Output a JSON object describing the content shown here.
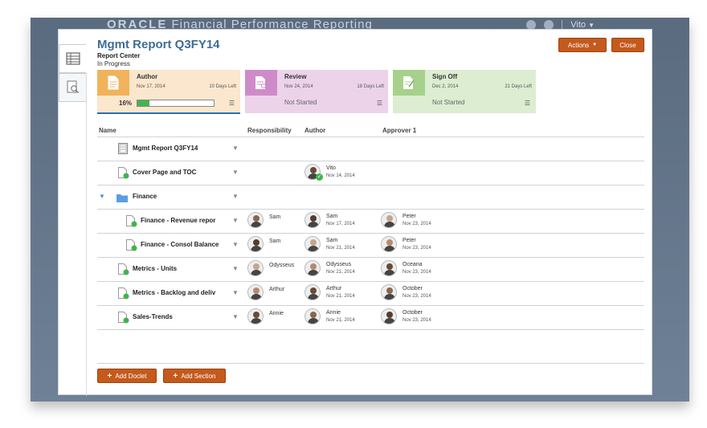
{
  "app": {
    "brand_oracle": "ORACLE",
    "brand_product": "Financial Performance Reporting",
    "user": "Vito"
  },
  "report": {
    "title": "Mgmt Report Q3FY14",
    "subtitle": "Report Center",
    "status": "In Progress"
  },
  "buttons": {
    "actions": "Actions",
    "close": "Close",
    "add_doclet": "Add Doclet",
    "add_section": "Add Section"
  },
  "stages": {
    "author": {
      "name": "Author",
      "date": "Nov 17, 2014",
      "days_left": "10 Days Left",
      "percent": "16%",
      "progress": 0.16
    },
    "review": {
      "name": "Review",
      "date": "Nov 24, 2014",
      "days_left": "18 Days Left",
      "status": "Not Started"
    },
    "signoff": {
      "name": "Sign Off",
      "date": "Dec 2, 2014",
      "days_left": "21 Days Left",
      "status": "Not Started"
    }
  },
  "columns": {
    "name": "Name",
    "responsibility": "Responsibility",
    "author": "Author",
    "approver": "Approver 1"
  },
  "rows": [
    {
      "name": "Mgmt Report Q3FY14"
    },
    {
      "name": "Cover Page and TOC",
      "author": {
        "name": "Vito",
        "date": "Nov 14, 2014"
      }
    },
    {
      "name": "Finance"
    },
    {
      "name": "Finance - Revenue repor",
      "responsibility": "Sam",
      "author": {
        "name": "Sam",
        "date": "Nov 17, 2014"
      },
      "approver": {
        "name": "Peter",
        "date": "Nov 23, 2014"
      }
    },
    {
      "name": "Finance - Consol Balance",
      "responsibility": "Sam",
      "author": {
        "name": "Sam",
        "date": "Nov 21, 2014"
      },
      "approver": {
        "name": "Peter",
        "date": "Nov 23, 2014"
      }
    },
    {
      "name": "Metrics - Units",
      "responsibility": "Odysseus",
      "author": {
        "name": "Odysseus",
        "date": "Nov 21, 2014"
      },
      "approver": {
        "name": "Oceana",
        "date": "Nov 23, 2014"
      }
    },
    {
      "name": "Metrics - Backlog and deliv",
      "responsibility": "Arthur",
      "author": {
        "name": "Arthur",
        "date": "Nov 21, 2014"
      },
      "approver": {
        "name": "October",
        "date": "Nov 23, 2014"
      }
    },
    {
      "name": "Sales-Trends",
      "responsibility": "Annie",
      "author": {
        "name": "Annie",
        "date": "Nov 21, 2014"
      },
      "approver": {
        "name": "October",
        "date": "Nov 23, 2014"
      }
    }
  ],
  "colors": {
    "accent": "#c45a1c",
    "title_blue": "#3f6c96",
    "author_stage": "#f0b35b",
    "review_stage": "#cf8bc9",
    "signoff_stage": "#a6d18b",
    "progress_green": "#42b64c"
  }
}
